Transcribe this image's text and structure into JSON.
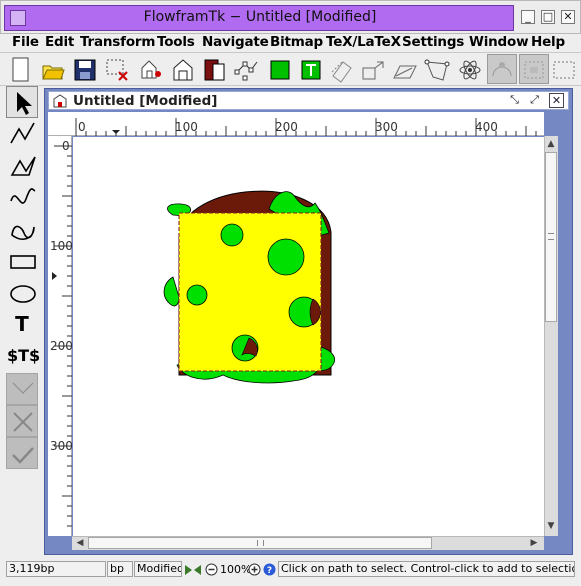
{
  "window": {
    "title": "FlowframTk − Untitled [Modified]"
  },
  "menu": {
    "items": [
      {
        "label": "File",
        "mnemonic": "F"
      },
      {
        "label": "Edit",
        "mnemonic": "E"
      },
      {
        "label": "Transform",
        "mnemonic": "T"
      },
      {
        "label": "Tools",
        "mnemonic": "o"
      },
      {
        "label": "Navigate",
        "mnemonic": "N"
      },
      {
        "label": "Bitmap",
        "mnemonic": "B"
      },
      {
        "label": "TeX/LaTeX",
        "mnemonic": "X"
      },
      {
        "label": "Settings",
        "mnemonic": "S"
      },
      {
        "label": "Window",
        "mnemonic": "W"
      },
      {
        "label": "Help",
        "mnemonic": "H"
      }
    ]
  },
  "toolbar": {
    "buttons": [
      "new-icon",
      "open-icon",
      "save-icon",
      "select-area-icon",
      "move-icon",
      "grid-icon",
      "front-icon",
      "back-icon",
      "edit-path-icon",
      "fill-color-icon",
      "text-color-icon",
      "rotate-icon",
      "scale-icon",
      "shear-icon",
      "distort-icon",
      "atom-icon",
      "pattern-icon",
      "bitmap-icon"
    ]
  },
  "tools": {
    "items": [
      "select-tool-icon",
      "open-line-icon",
      "closed-line-icon",
      "open-curve-icon",
      "closed-curve-icon",
      "rectangle-icon",
      "ellipse-icon",
      "text-icon",
      "math-text-icon",
      "disabled-tool-1",
      "disabled-tool-2",
      "disabled-tool-3"
    ],
    "math_text_label": "$T$",
    "text_label": "T"
  },
  "document": {
    "title": "Untitled [Modified]",
    "unit_label": "bp",
    "h_ticks": [
      "0",
      "100",
      "200",
      "300",
      "400"
    ],
    "v_ticks": [
      "0",
      "100",
      "200",
      "300"
    ]
  },
  "colors": {
    "cheese": "#ffff00",
    "holes": "#00e000",
    "crust": "#6b1a0a",
    "title_bg": "#b16bf0",
    "frame_bg": "#7688c4"
  },
  "status": {
    "position": "3,119bp",
    "unit": "bp",
    "modified": "Modified",
    "zoom": "100%",
    "help_message": "Click on path to select. Control-click to add to selection. Doub"
  }
}
